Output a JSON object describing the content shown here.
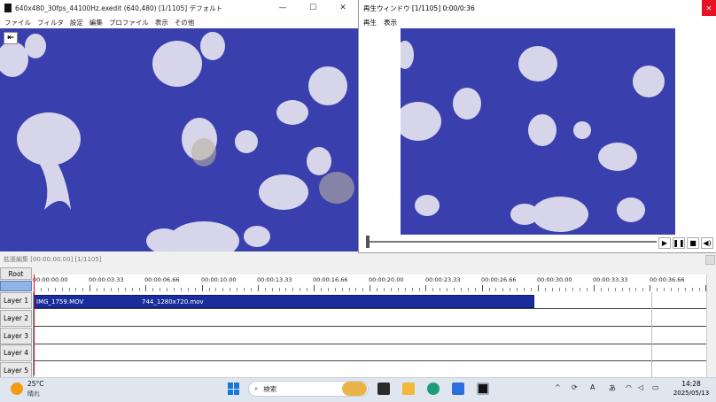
{
  "main_window": {
    "title": "640x480_30fps_44100Hz.exedit (640,480)  [1/1105]  デフォルト",
    "menu": [
      "ファイル",
      "フィルタ",
      "設定",
      "編集",
      "プロファイル",
      "表示",
      "その他"
    ],
    "window_controls": [
      "—",
      "☐",
      "✕"
    ]
  },
  "preview_window": {
    "title": "再生ウィンドウ  [1/1105]  0:00/0:36",
    "menu": [
      "再生",
      "表示"
    ],
    "close": "✕",
    "seek_fraction": 0.0,
    "controls": [
      "▶",
      "❚❚",
      "■",
      "◀)"
    ]
  },
  "timeline": {
    "title": "拡張編集 [00:00:00.00] [1/1105]",
    "root_label": "Root",
    "ruler_labels": [
      "00:00:00.00",
      "00:00:03.33",
      "00:00:06.66",
      "00:00:10.00",
      "00:00:13.33",
      "00:00:16.66",
      "00:00:20.00",
      "00:00:23.33",
      "00:00:26.66",
      "00:00:30.00",
      "00:00:33.33",
      "00:00:36.66"
    ],
    "layers": [
      "Layer 1",
      "Layer 2",
      "Layer 3",
      "Layer 4",
      "Layer 5"
    ],
    "clip_labels": [
      "IMG_1759.MOV",
      "744_1280x720.mov"
    ]
  },
  "taskbar": {
    "temperature": "25°C",
    "weather": "晴れ",
    "search_placeholder": "検索",
    "time": "14:28",
    "date": "2025/05/13"
  },
  "colors": {
    "video_bg": "#3a3fae",
    "clip": "#1a2d9c",
    "cursor": "#e00000"
  }
}
